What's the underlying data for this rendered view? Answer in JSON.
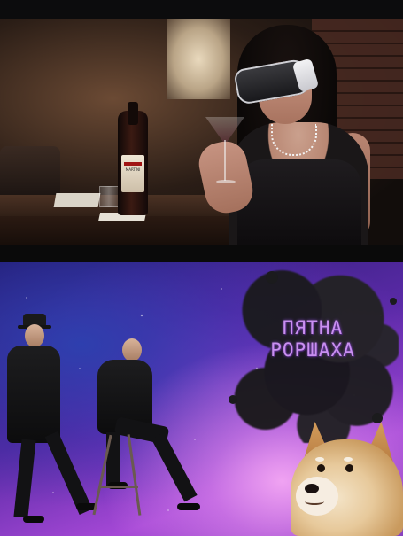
{
  "top_panel": {
    "bottle_label": "MARTINI"
  },
  "bottom_panel": {
    "title_lines": [
      "ПЯТНА",
      "РОРШАХА"
    ]
  }
}
